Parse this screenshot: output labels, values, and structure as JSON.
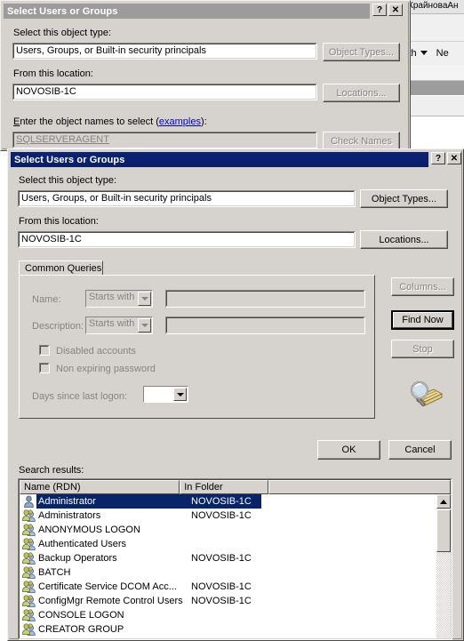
{
  "background_app": {
    "window_title": "КрайноваАн",
    "toolbar_text": "ith",
    "toolbar_text2": "Ne"
  },
  "dialog_back": {
    "title": "Select Users or Groups",
    "help_button": "?",
    "close_button": "✕",
    "object_type_label": "Select this object type:",
    "object_type_value": "Users, Groups, or Built-in security principals",
    "object_types_button": "Object Types...",
    "location_label": "From this location:",
    "location_value": "NOVOSIB-1C",
    "locations_button": "Locations...",
    "object_names_label_pre": "E",
    "object_names_label_mid": "nter the object names to select (",
    "object_names_link": "examples",
    "object_names_label_post": "):",
    "object_names_value": "SQLSERVERAGENT",
    "check_names_button": "Check Names"
  },
  "dialog_front": {
    "title": "Select Users or Groups",
    "help_button": "?",
    "close_button": "✕",
    "object_type_label": "Select this object type:",
    "object_type_value": "Users, Groups, or Built-in security principals",
    "object_types_button": "Object Types...",
    "location_label": "From this location:",
    "location_value": "NOVOSIB-1C",
    "locations_button": "Locations...",
    "tab_common_queries": "Common Queries",
    "name_label": "Name:",
    "name_condition": "Starts with",
    "name_value": "",
    "description_label": "Description:",
    "description_condition": "Starts with",
    "description_value": "",
    "disabled_accounts_label": "Disabled accounts",
    "non_expiring_password_label": "Non expiring password",
    "days_since_last_logon_label": "Days since last logon:",
    "days_since_last_logon_value": "",
    "columns_button": "Columns...",
    "find_now_button": "Find Now",
    "stop_button": "Stop",
    "ok_button": "OK",
    "cancel_button": "Cancel",
    "search_results_label": "Search results:",
    "columns": [
      "Name (RDN)",
      "In Folder",
      ""
    ],
    "rows": [
      {
        "icon": "user-icon",
        "name": "Administrator",
        "folder": "NOVOSIB-1C",
        "selected": true
      },
      {
        "icon": "group-icon",
        "name": "Administrators",
        "folder": "NOVOSIB-1C",
        "selected": false
      },
      {
        "icon": "group-icon",
        "name": "ANONYMOUS LOGON",
        "folder": "",
        "selected": false
      },
      {
        "icon": "group-icon",
        "name": "Authenticated Users",
        "folder": "",
        "selected": false
      },
      {
        "icon": "group-icon",
        "name": "Backup Operators",
        "folder": "NOVOSIB-1C",
        "selected": false
      },
      {
        "icon": "group-icon",
        "name": "BATCH",
        "folder": "",
        "selected": false
      },
      {
        "icon": "group-icon",
        "name": "Certificate Service DCOM Acc...",
        "folder": "NOVOSIB-1C",
        "selected": false
      },
      {
        "icon": "group-icon",
        "name": "ConfigMgr Remote Control Users",
        "folder": "NOVOSIB-1C",
        "selected": false
      },
      {
        "icon": "group-icon",
        "name": "CONSOLE LOGON",
        "folder": "",
        "selected": false
      },
      {
        "icon": "group-icon",
        "name": "CREATOR GROUP",
        "folder": "",
        "selected": false
      }
    ]
  },
  "colors": {
    "active_title": "#0a2472",
    "inactive_title": "#9c9c9c",
    "dialog_face": "#d6d3ce",
    "selection": "#0a246a",
    "link": "#0000c8",
    "disabled_text": "#868382"
  }
}
